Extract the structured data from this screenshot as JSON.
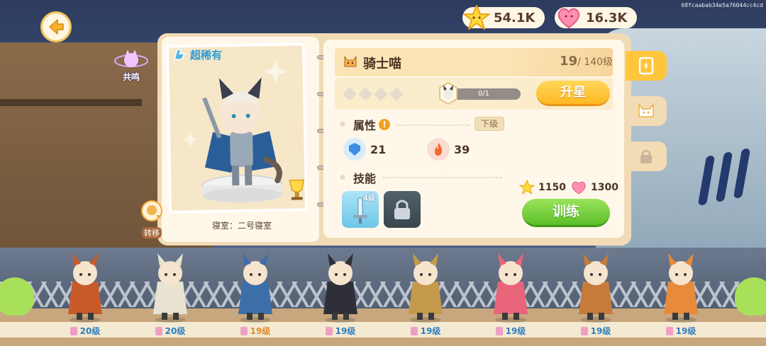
{
  "overlay_hash": "68fcaabab34e5a76044cc4cd",
  "currency": {
    "stars": "54.1K",
    "hearts": "16.3K"
  },
  "resonance_label": "共鸣",
  "transfer_label": "转移",
  "card": {
    "rarity": "超稀有",
    "dorm": "寝室：二号寝室"
  },
  "character": {
    "name": "骑士喵",
    "level": "19",
    "level_max": "/ 140级"
  },
  "star_up": {
    "progress_text": "0/1",
    "progress_value": 0,
    "button_label": "升星",
    "empty_stars": 4
  },
  "attributes": {
    "title": "属性",
    "info_icon": "!",
    "lower_level_label": "下级",
    "items": [
      {
        "icon": "blue-shield-icon",
        "value": "21"
      },
      {
        "icon": "fire-icon",
        "value": "39"
      }
    ]
  },
  "skills": {
    "title": "技能",
    "items": [
      {
        "icon": "sword-skill-icon",
        "level_badge": "4级",
        "locked": false
      },
      {
        "icon": "lock-icon",
        "level_badge": "",
        "locked": true
      }
    ]
  },
  "train": {
    "cost_stars": "1150",
    "cost_hearts": "1300",
    "button_label": "训练"
  },
  "side_tabs": [
    "card-tab",
    "cat-face-tab",
    "locked-tab"
  ],
  "roster": [
    {
      "level": "20级",
      "highlight": false
    },
    {
      "level": "20级",
      "highlight": false
    },
    {
      "level": "19级",
      "highlight": true
    },
    {
      "level": "19级",
      "highlight": false
    },
    {
      "level": "19级",
      "highlight": false
    },
    {
      "level": "19级",
      "highlight": false
    },
    {
      "level": "19级",
      "highlight": false
    },
    {
      "level": "19级",
      "highlight": false
    }
  ],
  "colors": {
    "panel": "#f1dbb6",
    "upstar_button": "#ffc23a",
    "train_button": "#6fcd35",
    "rarity_text": "#2f9ad3"
  }
}
